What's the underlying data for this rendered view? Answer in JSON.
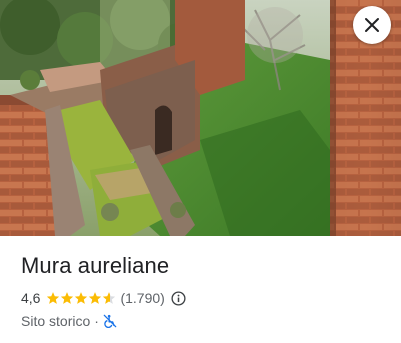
{
  "place": {
    "name": "Mura aureliane",
    "rating": "4,6",
    "rating_fraction": 0.92,
    "reviews": "(1.790)",
    "category": "Sito storico",
    "separator": "·"
  },
  "icons": {
    "close": "close-icon",
    "info": "info-icon",
    "accessibility": "no-wheelchair-access-icon"
  },
  "colors": {
    "star": "#fbbc04",
    "accessibility": "#1a73e8",
    "text_primary": "#202124",
    "text_secondary": "#5f6368"
  }
}
